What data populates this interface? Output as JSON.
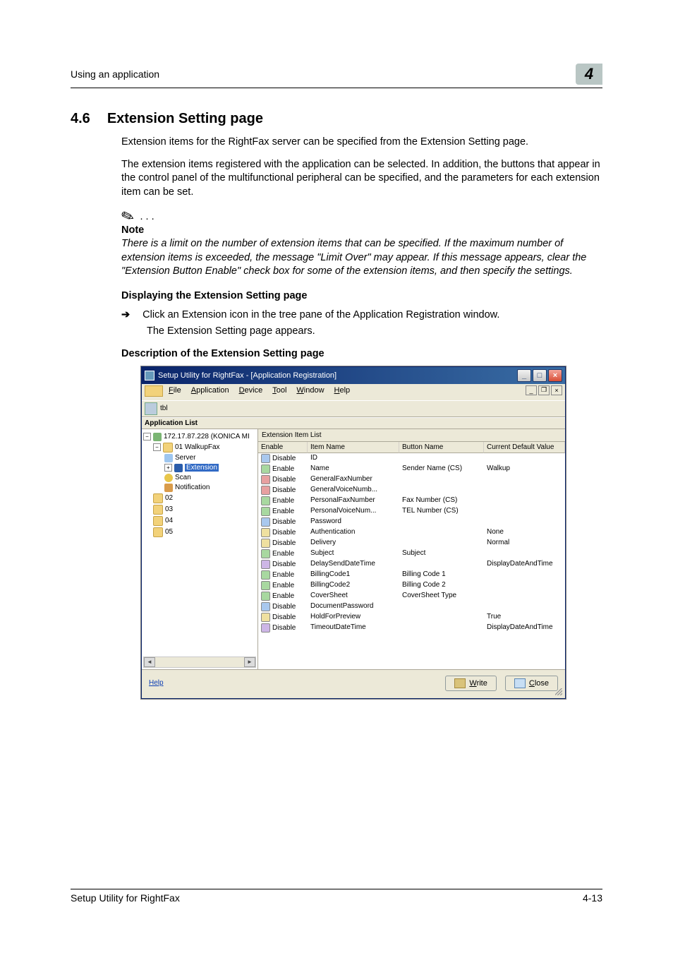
{
  "header": {
    "running_title": "Using an application",
    "chapter_number": "4"
  },
  "section": {
    "number": "4.6",
    "title": "Extension Setting page"
  },
  "body": {
    "p1": "Extension items for the RightFax server can be specified from the Extension Setting page.",
    "p2": "The extension items registered with the application can be selected. In addition, the buttons that appear in the control panel of the multifunctional peripheral can be specified, and the parameters for each extension item can be set."
  },
  "note": {
    "ellipsis": ". . .",
    "label": "Note",
    "text": "There is a limit on the number of extension items that can be specified. If the maximum number of extension items is exceeded, the message \"Limit Over\" may appear. If this message appears, clear the \"Extension Button Enable\" check box for some of the extension items, and then specify the settings."
  },
  "sub1": {
    "title": "Displaying the Extension Setting page",
    "step": "Click an Extension icon in the tree pane of the Application Registration window.",
    "result": "The Extension Setting page appears."
  },
  "sub2": {
    "title": "Description of the Extension Setting page"
  },
  "shot": {
    "title": "Setup Utility for RightFax - [Application Registration]",
    "menus": [
      "File",
      "Application",
      "Device",
      "Tool",
      "Window",
      "Help"
    ],
    "toolbar_label": "tbl",
    "pane_label": "Application List",
    "tree": {
      "root": "172.17.87.228 (KONICA MI",
      "app": "01 WalkupFax",
      "server": "Server",
      "extension": "Extension",
      "scan": "Scan",
      "notification": "Notification",
      "n2": "02",
      "n3": "03",
      "n4": "04",
      "n5": "05"
    },
    "list_title": "Extension Item List",
    "columns": {
      "c1": "Enable",
      "c2": "Item Name",
      "c3": "Button Name",
      "c4": "Current Default Value"
    },
    "rows": [
      {
        "enable": "Disable",
        "chip": "b",
        "item": "ID",
        "button": "",
        "value": ""
      },
      {
        "enable": "Enable",
        "chip": "g",
        "item": "Name",
        "button": "Sender Name (CS)",
        "value": "Walkup"
      },
      {
        "enable": "Disable",
        "chip": "r",
        "item": "GeneralFaxNumber",
        "button": "",
        "value": ""
      },
      {
        "enable": "Disable",
        "chip": "r",
        "item": "GeneralVoiceNumb...",
        "button": "",
        "value": ""
      },
      {
        "enable": "Enable",
        "chip": "g",
        "item": "PersonalFaxNumber",
        "button": "Fax Number (CS)",
        "value": ""
      },
      {
        "enable": "Enable",
        "chip": "g",
        "item": "PersonalVoiceNum...",
        "button": "TEL Number (CS)",
        "value": ""
      },
      {
        "enable": "Disable",
        "chip": "b",
        "item": "Password",
        "button": "",
        "value": ""
      },
      {
        "enable": "Disable",
        "chip": "y",
        "item": "Authentication",
        "button": "",
        "value": "None"
      },
      {
        "enable": "Disable",
        "chip": "y",
        "item": "Delivery",
        "button": "",
        "value": "Normal"
      },
      {
        "enable": "Enable",
        "chip": "g",
        "item": "Subject",
        "button": "Subject",
        "value": ""
      },
      {
        "enable": "Disable",
        "chip": "p",
        "item": "DelaySendDateTime",
        "button": "",
        "value": "DisplayDateAndTime"
      },
      {
        "enable": "Enable",
        "chip": "g",
        "item": "BillingCode1",
        "button": "Billing Code 1",
        "value": ""
      },
      {
        "enable": "Enable",
        "chip": "g",
        "item": "BillingCode2",
        "button": "Billing Code 2",
        "value": ""
      },
      {
        "enable": "Enable",
        "chip": "g",
        "item": "CoverSheet",
        "button": "CoverSheet Type",
        "value": ""
      },
      {
        "enable": "Disable",
        "chip": "b",
        "item": "DocumentPassword",
        "button": "",
        "value": ""
      },
      {
        "enable": "Disable",
        "chip": "y",
        "item": "HoldForPreview",
        "button": "",
        "value": "True"
      },
      {
        "enable": "Disable",
        "chip": "p",
        "item": "TimeoutDateTime",
        "button": "",
        "value": "DisplayDateAndTime"
      }
    ],
    "footer": {
      "help": "Help",
      "write": "Write",
      "close": "Close"
    }
  },
  "footer": {
    "product": "Setup Utility for RightFax",
    "page": "4-13"
  }
}
